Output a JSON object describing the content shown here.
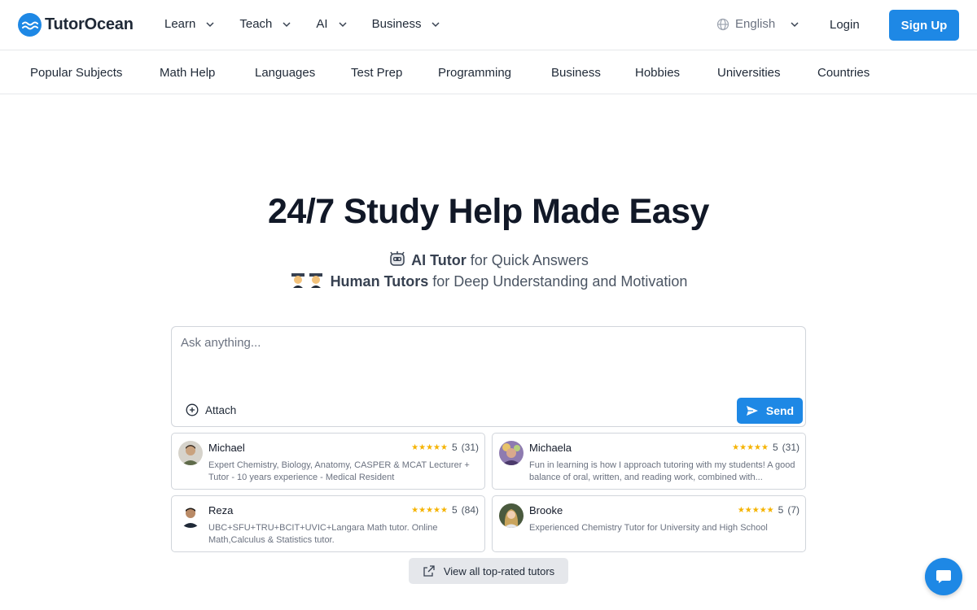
{
  "brand": {
    "name": "TutorOcean",
    "color": "#1e88e5"
  },
  "topnav": [
    {
      "label": "Learn"
    },
    {
      "label": "Teach"
    },
    {
      "label": "AI"
    },
    {
      "label": "Business"
    }
  ],
  "header": {
    "language": "English",
    "login": "Login",
    "signup": "Sign Up"
  },
  "subjects": [
    "Popular Subjects",
    "Math Help",
    "Languages",
    "Test Prep",
    "Programming",
    "Business",
    "Hobbies",
    "Universities",
    "Countries"
  ],
  "hero": {
    "title": "24/7 Study Help Made Easy",
    "line1_bold": "AI Tutor",
    "line1_rest": " for Quick Answers",
    "line2_bold": "Human Tutors",
    "line2_rest": " for Deep Understanding and Motivation"
  },
  "ask": {
    "placeholder": "Ask anything...",
    "attach": "Attach",
    "send": "Send"
  },
  "tutors": [
    {
      "name": "Michael",
      "rating": "5",
      "count": "(31)",
      "desc": "Expert Chemistry, Biology, Anatomy, CASPER & MCAT Lecturer + Tutor - 10 years experience - Medical Resident"
    },
    {
      "name": "Michaela",
      "rating": "5",
      "count": "(31)",
      "desc": "Fun in learning is how I approach tutoring with my students! A good balance of oral, written, and reading work, combined with..."
    },
    {
      "name": "Reza",
      "rating": "5",
      "count": "(84)",
      "desc": "UBC+SFU+TRU+BCIT+UVIC+Langara Math tutor. Online Math,Calculus & Statistics tutor."
    },
    {
      "name": "Brooke",
      "rating": "5",
      "count": "(7)",
      "desc": "Experienced Chemistry Tutor for University and High School"
    }
  ],
  "stars": "★★★★★",
  "view_all": "View all top-rated tutors"
}
